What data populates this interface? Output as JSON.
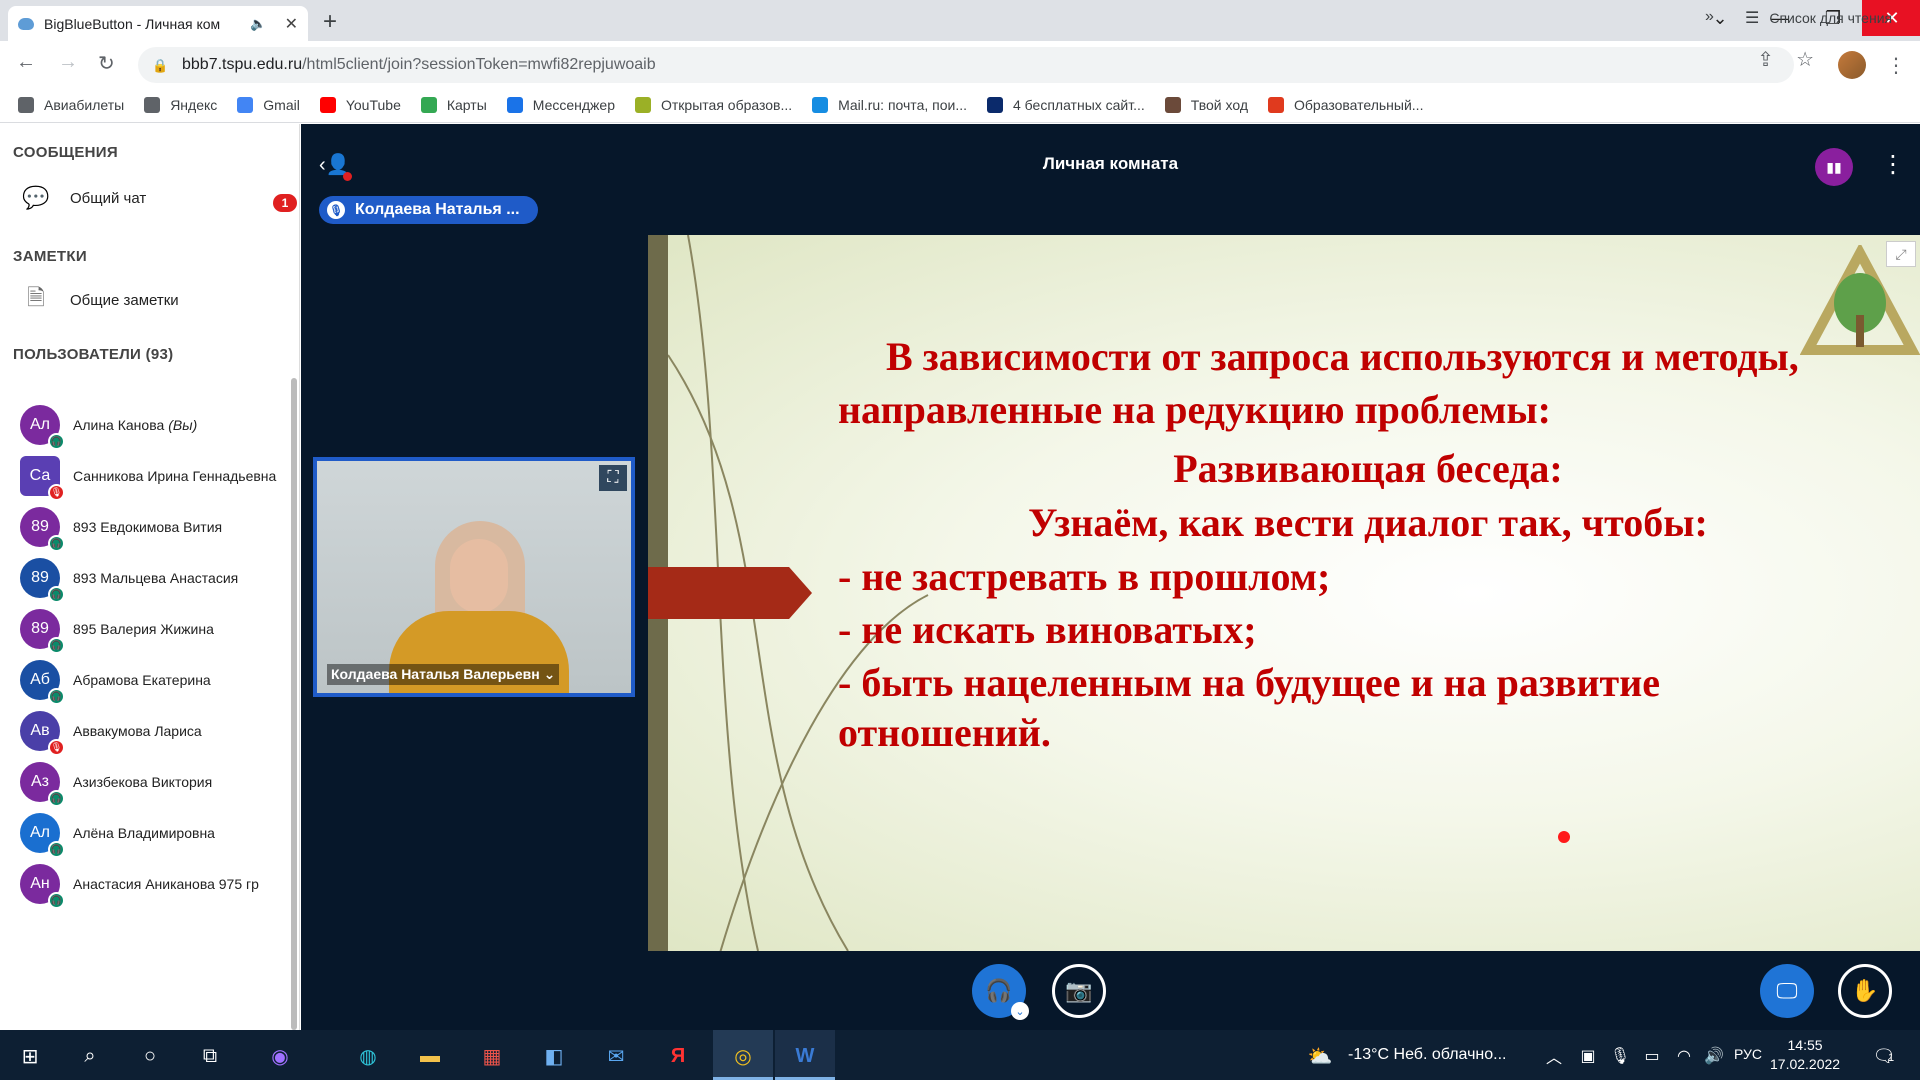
{
  "browser": {
    "tab": {
      "title": "BigBlueButton - Личная ком"
    },
    "url": {
      "host": "bbb7.tspu.edu.ru",
      "path": "/html5client/join?sessionToken=mwfi82repjuwoaib"
    },
    "bookmarks": [
      {
        "label": "Авиабилеты",
        "icon": "globe-icon",
        "color": "#5f6368"
      },
      {
        "label": "Яндекс",
        "icon": "globe-icon",
        "color": "#5f6368"
      },
      {
        "label": "Gmail",
        "icon": "google-icon",
        "color": "#4285f4"
      },
      {
        "label": "YouTube",
        "icon": "youtube-icon",
        "color": "#ff0000"
      },
      {
        "label": "Карты",
        "icon": "maps-icon",
        "color": "#34a853"
      },
      {
        "label": "Мессенджер",
        "icon": "messenger-icon",
        "color": "#1a73e8"
      },
      {
        "label": "Открытая образов...",
        "icon": "leaf-icon",
        "color": "#9bb026"
      },
      {
        "label": "Mail.ru: почта, пои...",
        "icon": "mailru-icon",
        "color": "#168de2"
      },
      {
        "label": "4 бесплатных сайт...",
        "icon": "nr-icon",
        "color": "#0b2a6b"
      },
      {
        "label": "Твой ход",
        "icon": "circle-icon",
        "color": "#6b4a3a"
      },
      {
        "label": "Образовательный...",
        "icon": "torch-icon",
        "color": "#e03a1e"
      }
    ],
    "reading_list": "Список для чтения"
  },
  "sidebar": {
    "messages_title": "СООБЩЕНИЯ",
    "public_chat": "Общий чат",
    "public_chat_unread": "1",
    "notes_title": "ЗАМЕТКИ",
    "shared_notes": "Общие заметки",
    "users_title": "ПОЛЬЗОВАТЕЛИ",
    "users_count": "(93)",
    "users": [
      {
        "initials": "Ал",
        "name": "Алина Канова",
        "you": "(Вы)",
        "color": "#7b2a9e",
        "status": "listen"
      },
      {
        "initials": "Са",
        "name": "Санникова Ирина Геннадьевна",
        "you": "",
        "color": "#5a3fb3",
        "status": "muted",
        "presenter": true
      },
      {
        "initials": "89",
        "name": "893 Евдокимова Вития",
        "you": "",
        "color": "#7b2a9e",
        "status": "listen"
      },
      {
        "initials": "89",
        "name": "893 Мальцева Анастасия",
        "you": "",
        "color": "#1a4fa3",
        "status": "listen"
      },
      {
        "initials": "89",
        "name": "895 Валерия Жижина",
        "you": "",
        "color": "#7b2a9e",
        "status": "listen"
      },
      {
        "initials": "Аб",
        "name": "Абрамова Екатерина",
        "you": "",
        "color": "#1a4fa3",
        "status": "listen"
      },
      {
        "initials": "Ав",
        "name": "Аввакумова Лариса",
        "you": "",
        "color": "#4a3fa8",
        "status": "muted"
      },
      {
        "initials": "Аз",
        "name": "Азизбекова Виктория",
        "you": "",
        "color": "#7b2a9e",
        "status": "listen"
      },
      {
        "initials": "Ал",
        "name": "Алёна Владимировна",
        "you": "",
        "color": "#1a6fd0",
        "status": "listen"
      },
      {
        "initials": "Ан",
        "name": "Анастасия Аниканова 975 гр",
        "you": "",
        "color": "#7b2a9e",
        "status": "listen"
      }
    ]
  },
  "main": {
    "room_title": "Личная комната",
    "talking_indicator": "Колдаева Наталья ...",
    "webcam_name": "Колдаева Наталья Валерьевн",
    "slide": {
      "line1": "В зависимости от запроса используются и методы,",
      "line2": "направленные на редукцию проблемы:",
      "line3": "Развивающая беседа:",
      "line4": "Узнаём, как вести диалог так, чтобы:",
      "line5": "- не застревать в прошлом;",
      "line6": "- не искать виноватых;",
      "line7": "- быть нацеленным на будущее и на развитие",
      "line8": "отношений."
    }
  },
  "taskbar": {
    "weather": "-13°C  Неб. облачно...",
    "lang": "РУС",
    "time": "14:55",
    "date": "17.02.2022",
    "notif_count": "1"
  }
}
